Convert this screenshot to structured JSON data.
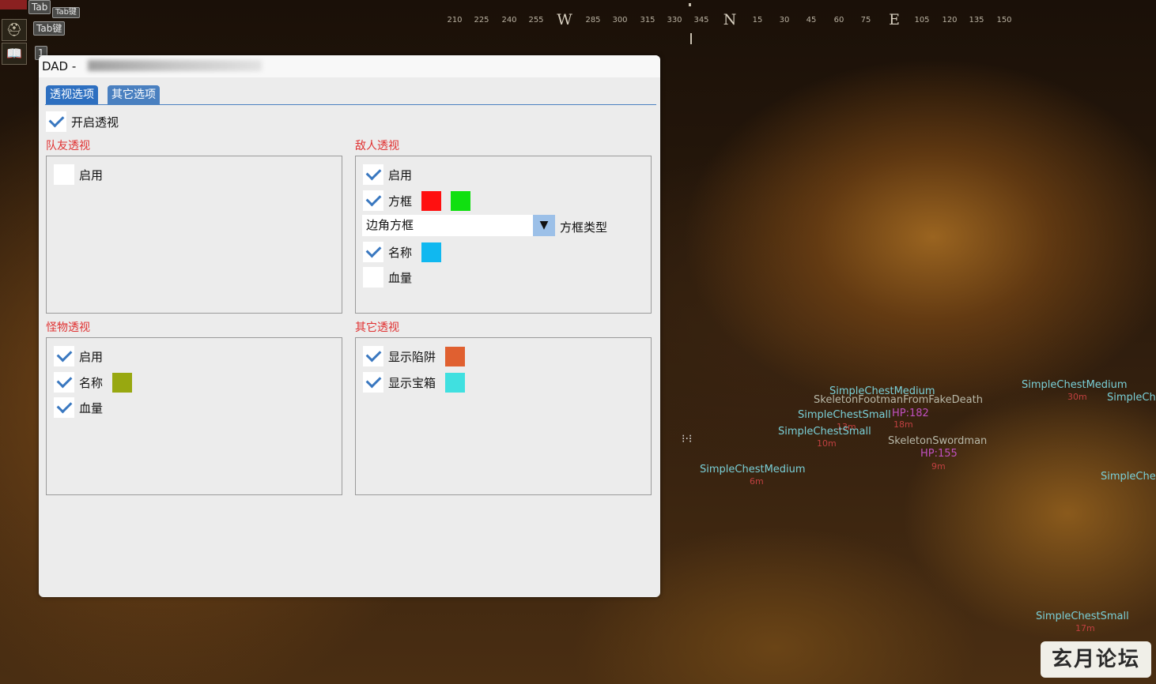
{
  "hud": {
    "key_top_a": "Tab",
    "key_top_b": "Tab键",
    "key_mid": "Tab键",
    "key_bottom": "1",
    "icon_a": "helmet-icon",
    "icon_b": "book-icon"
  },
  "compass": {
    "ticks": [
      "210",
      "225",
      "240",
      "255",
      "285",
      "300",
      "315",
      "330",
      "345",
      "15",
      "30",
      "45",
      "60",
      "75",
      "105",
      "120",
      "135",
      "150"
    ],
    "cardinals": [
      "W",
      "N",
      "E"
    ]
  },
  "window": {
    "title": "DAD - ",
    "tabs": [
      "透视选项",
      "其它选项"
    ],
    "master_toggle": {
      "label": "开启透视",
      "checked": true
    },
    "teammate": {
      "title": "队友透视",
      "enable": {
        "label": "启用",
        "checked": false
      }
    },
    "enemy": {
      "title": "敌人透视",
      "enable": {
        "label": "启用",
        "checked": true
      },
      "box": {
        "label": "方框",
        "checked": true,
        "colors": [
          "#ff1010",
          "#10e010"
        ]
      },
      "box_type_value": "边角方框",
      "box_type_label": "方框类型",
      "name": {
        "label": "名称",
        "checked": true,
        "color": "#10b8f0"
      },
      "health": {
        "label": "血量",
        "checked": false
      }
    },
    "monster": {
      "title": "怪物透视",
      "enable": {
        "label": "启用",
        "checked": true
      },
      "name": {
        "label": "名称",
        "checked": true,
        "color": "#98a810"
      },
      "health": {
        "label": "血量",
        "checked": true
      }
    },
    "other": {
      "title": "其它透视",
      "traps": {
        "label": "显示陷阱",
        "checked": true,
        "color": "#e06030"
      },
      "chests": {
        "label": "显示宝箱",
        "checked": true,
        "color": "#40e0e0"
      }
    }
  },
  "world_labels": {
    "l1": "SimpleChestMedium",
    "l2": "SkeletonFootmanFromFakeDeath",
    "l3": "SimpleChestSmall",
    "l3b": "HP:182",
    "l4": "SimpleChestSmall",
    "l5": "SkeletonSwordman",
    "l5b": "HP:155",
    "l6": "SimpleChestMedium",
    "l7": "SimpleChestMedium",
    "l8": "SimpleChestSmall",
    "d1": "13m",
    "d2": "18m",
    "d3": "10m",
    "d4": "6m",
    "d5": "9m",
    "d6": "17m",
    "d7": "30m",
    "r1": "SimpleCh",
    "r2": "SimpleChe"
  },
  "watermark": "玄月论坛"
}
